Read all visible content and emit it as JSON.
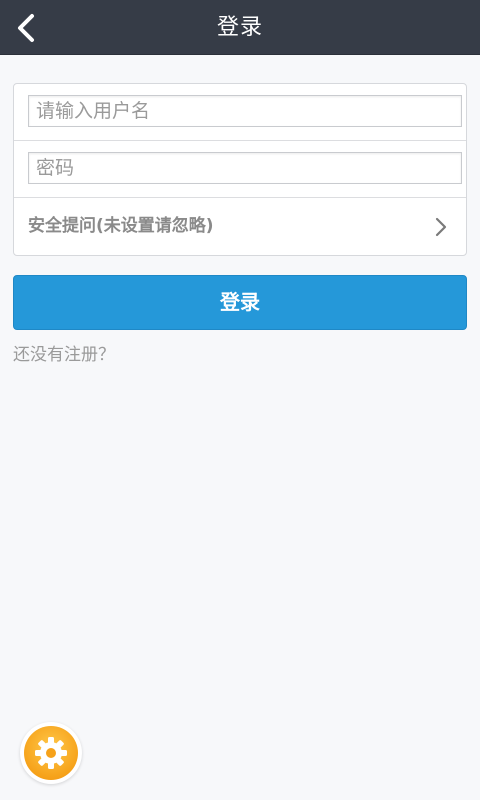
{
  "header": {
    "title": "登录",
    "back_icon": "chevron-left-icon"
  },
  "form": {
    "username": {
      "placeholder": "请输入用户名",
      "value": ""
    },
    "password": {
      "placeholder": "密码",
      "value": ""
    },
    "security_question": {
      "label": "安全提问(未设置请忽略)",
      "icon": "chevron-right-icon"
    }
  },
  "actions": {
    "login_label": "登录",
    "register_link": "还没有注册？"
  },
  "floating": {
    "settings_icon": "gear-icon"
  },
  "colors": {
    "header_bg": "#363c47",
    "primary": "#2598d9",
    "page_bg": "#f7f8fa",
    "fab_orange": "#f6a21a"
  }
}
